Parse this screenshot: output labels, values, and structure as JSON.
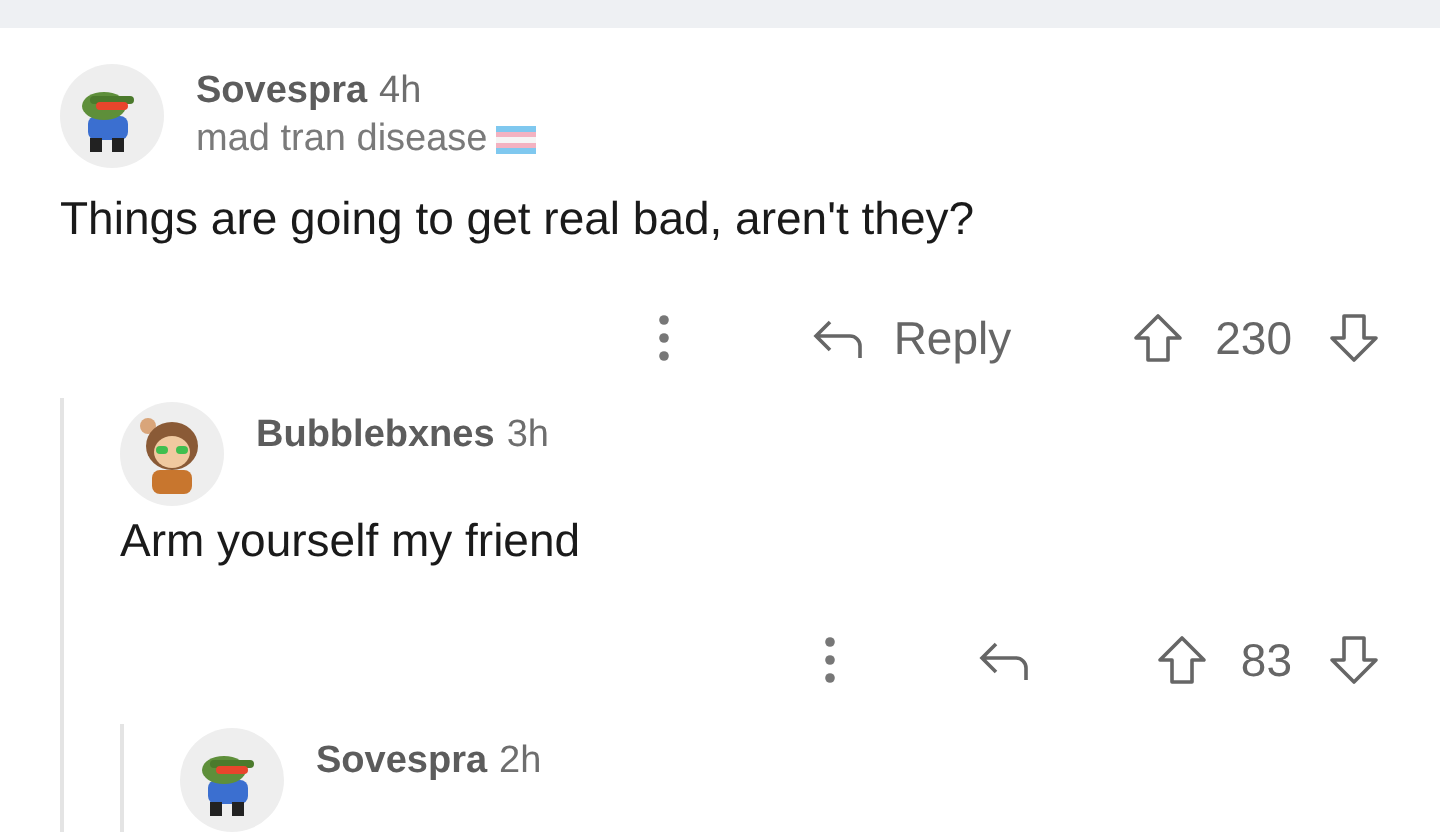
{
  "comments": [
    {
      "user": "Sovespra",
      "time": "4h",
      "flair": "mad tran disease",
      "body": "Things are going to get real bad, aren't they?",
      "reply_label": "Reply",
      "score": "230",
      "kind": "green-cap",
      "children": [
        {
          "user": "Bubblebxnes",
          "time": "3h",
          "body": "Arm yourself my friend",
          "score": "83",
          "kind": "brown-hair",
          "children": [
            {
              "user": "Sovespra",
              "time": "2h",
              "kind": "green-cap"
            }
          ]
        }
      ]
    }
  ]
}
